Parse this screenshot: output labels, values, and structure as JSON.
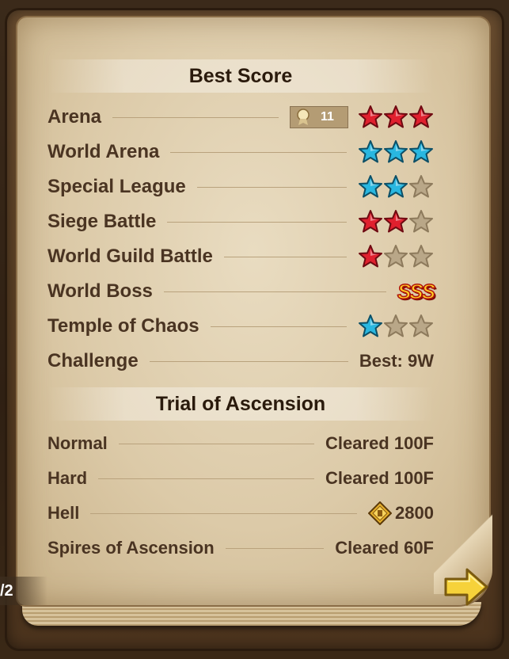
{
  "best_score": {
    "title": "Best Score",
    "rows": [
      {
        "label": "Arena",
        "rank_badge": "11",
        "stars": [
          "red",
          "red",
          "red"
        ]
      },
      {
        "label": "World Arena",
        "stars": [
          "blue",
          "blue",
          "blue"
        ]
      },
      {
        "label": "Special League",
        "stars": [
          "blue",
          "blue",
          "empty"
        ]
      },
      {
        "label": "Siege Battle",
        "stars": [
          "red",
          "red",
          "empty"
        ]
      },
      {
        "label": "World Guild Battle",
        "stars": [
          "red",
          "empty",
          "empty"
        ]
      },
      {
        "label": "World Boss",
        "rank_text": "SSS"
      },
      {
        "label": "Temple of Chaos",
        "stars": [
          "blue",
          "empty",
          "empty"
        ]
      },
      {
        "label": "Challenge",
        "value": "Best: 9W"
      }
    ]
  },
  "trial_of_ascension": {
    "title": "Trial of Ascension",
    "rows": [
      {
        "label": "Normal",
        "value": "Cleared 100F"
      },
      {
        "label": "Hard",
        "value": "Cleared 100F"
      },
      {
        "label": "Hell",
        "value": "2800",
        "icon": "gold-coin-icon"
      },
      {
        "label": "Spires of Ascension",
        "value": "Cleared 60F"
      }
    ]
  },
  "page_indicator": "/2",
  "colors": {
    "red_star": "#e0202e",
    "blue_star": "#29b7e0",
    "empty_star": "#b9a788",
    "text": "#4a3422"
  }
}
